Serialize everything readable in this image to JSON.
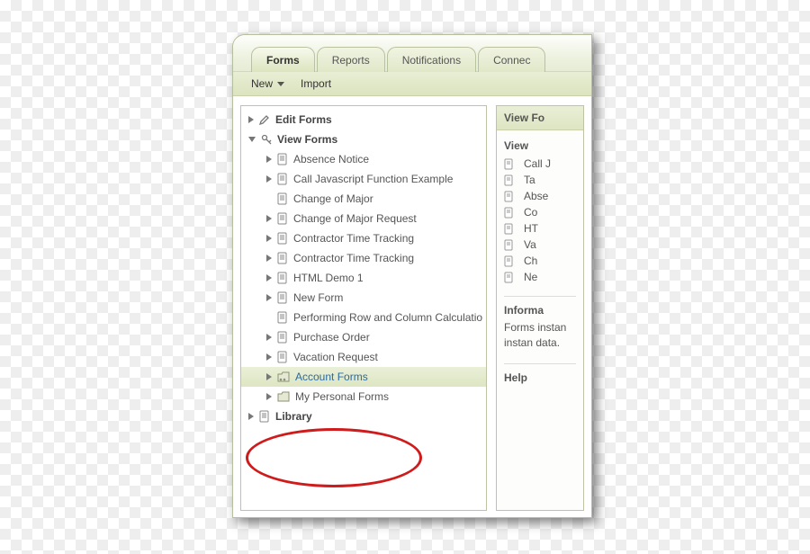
{
  "tabs": [
    "Forms",
    "Reports",
    "Notifications",
    "Connec"
  ],
  "active_tab_index": 0,
  "toolbar": {
    "new_label": "New",
    "import_label": "Import"
  },
  "tree": {
    "edit_forms": "Edit Forms",
    "view_forms": "View Forms",
    "library": "Library",
    "items": [
      {
        "label": "Absence Notice",
        "expandable": true
      },
      {
        "label": "Call Javascript Function Example",
        "expandable": true
      },
      {
        "label": "Change of Major",
        "expandable": false
      },
      {
        "label": "Change of Major Request",
        "expandable": true
      },
      {
        "label": "Contractor Time Tracking",
        "expandable": true
      },
      {
        "label": "Contractor Time Tracking",
        "expandable": true
      },
      {
        "label": "HTML Demo 1",
        "expandable": true
      },
      {
        "label": "New Form",
        "expandable": true
      },
      {
        "label": "Performing Row and Column Calculatio",
        "expandable": false
      },
      {
        "label": "Purchase Order",
        "expandable": true
      },
      {
        "label": "Vacation Request",
        "expandable": true
      }
    ],
    "folders": [
      {
        "label": "Account Forms",
        "selected": true,
        "shared": true
      },
      {
        "label": "My Personal Forms",
        "selected": false,
        "shared": false
      }
    ]
  },
  "side": {
    "header": "View Fo",
    "views_title": "View",
    "view_items": [
      "Call J",
      "Ta",
      "Abse",
      "Co",
      "HT",
      "Va",
      "Ch",
      "Ne"
    ],
    "info_title": "Informa",
    "info_text": "Forms instan instan data.",
    "help_title": "Help"
  }
}
